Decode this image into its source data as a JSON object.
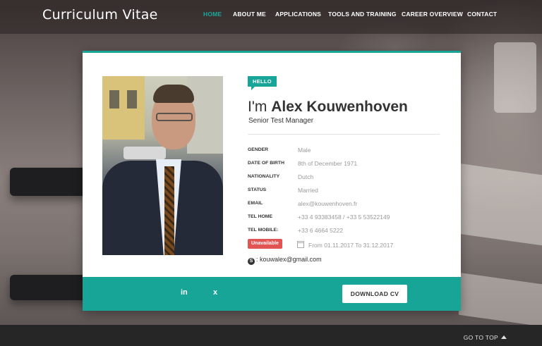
{
  "brand": "Curriculum Vitae",
  "nav": [
    {
      "label": "HOME",
      "active": true
    },
    {
      "label": "ABOUT ME"
    },
    {
      "label": "APPLICATIONS"
    },
    {
      "label": "TOOLS AND TRAINING"
    },
    {
      "label": "CAREER OVERVIEW"
    },
    {
      "label": "CONTACT"
    }
  ],
  "profile": {
    "badge": "HELLO",
    "greeting": "I'm",
    "name": "Alex Kouwenhoven",
    "title": "Senior Test Manager",
    "details": [
      {
        "key": "GENDER",
        "value": "Male"
      },
      {
        "key": "DATE OF BIRTH",
        "value": "8th of December 1971"
      },
      {
        "key": "NATIONALITY",
        "value": "Dutch"
      },
      {
        "key": "STATUS",
        "value": "Married"
      },
      {
        "key": "EMAIL",
        "value": "alex@kouwenhoven.fr"
      },
      {
        "key": "TEL HOME",
        "value": "+33 4 93383458 / +33 5 53522149"
      },
      {
        "key": "TEL MOBILE:",
        "value": "+33 6 4664 5222"
      }
    ],
    "availability": {
      "label": "Unavailable",
      "range": "From 01.11.2017 To 31.12.2017"
    },
    "skype": ": kouwalex@gmail.com"
  },
  "footer": {
    "social": [
      {
        "icon": "linkedin-icon",
        "text": "in"
      },
      {
        "icon": "xing-icon",
        "text": "x"
      }
    ],
    "download_label": "DOWNLOAD CV"
  },
  "bottom": {
    "go_to_top": "GO TO TOP"
  },
  "colors": {
    "accent": "#16a596",
    "danger": "#e25454"
  }
}
